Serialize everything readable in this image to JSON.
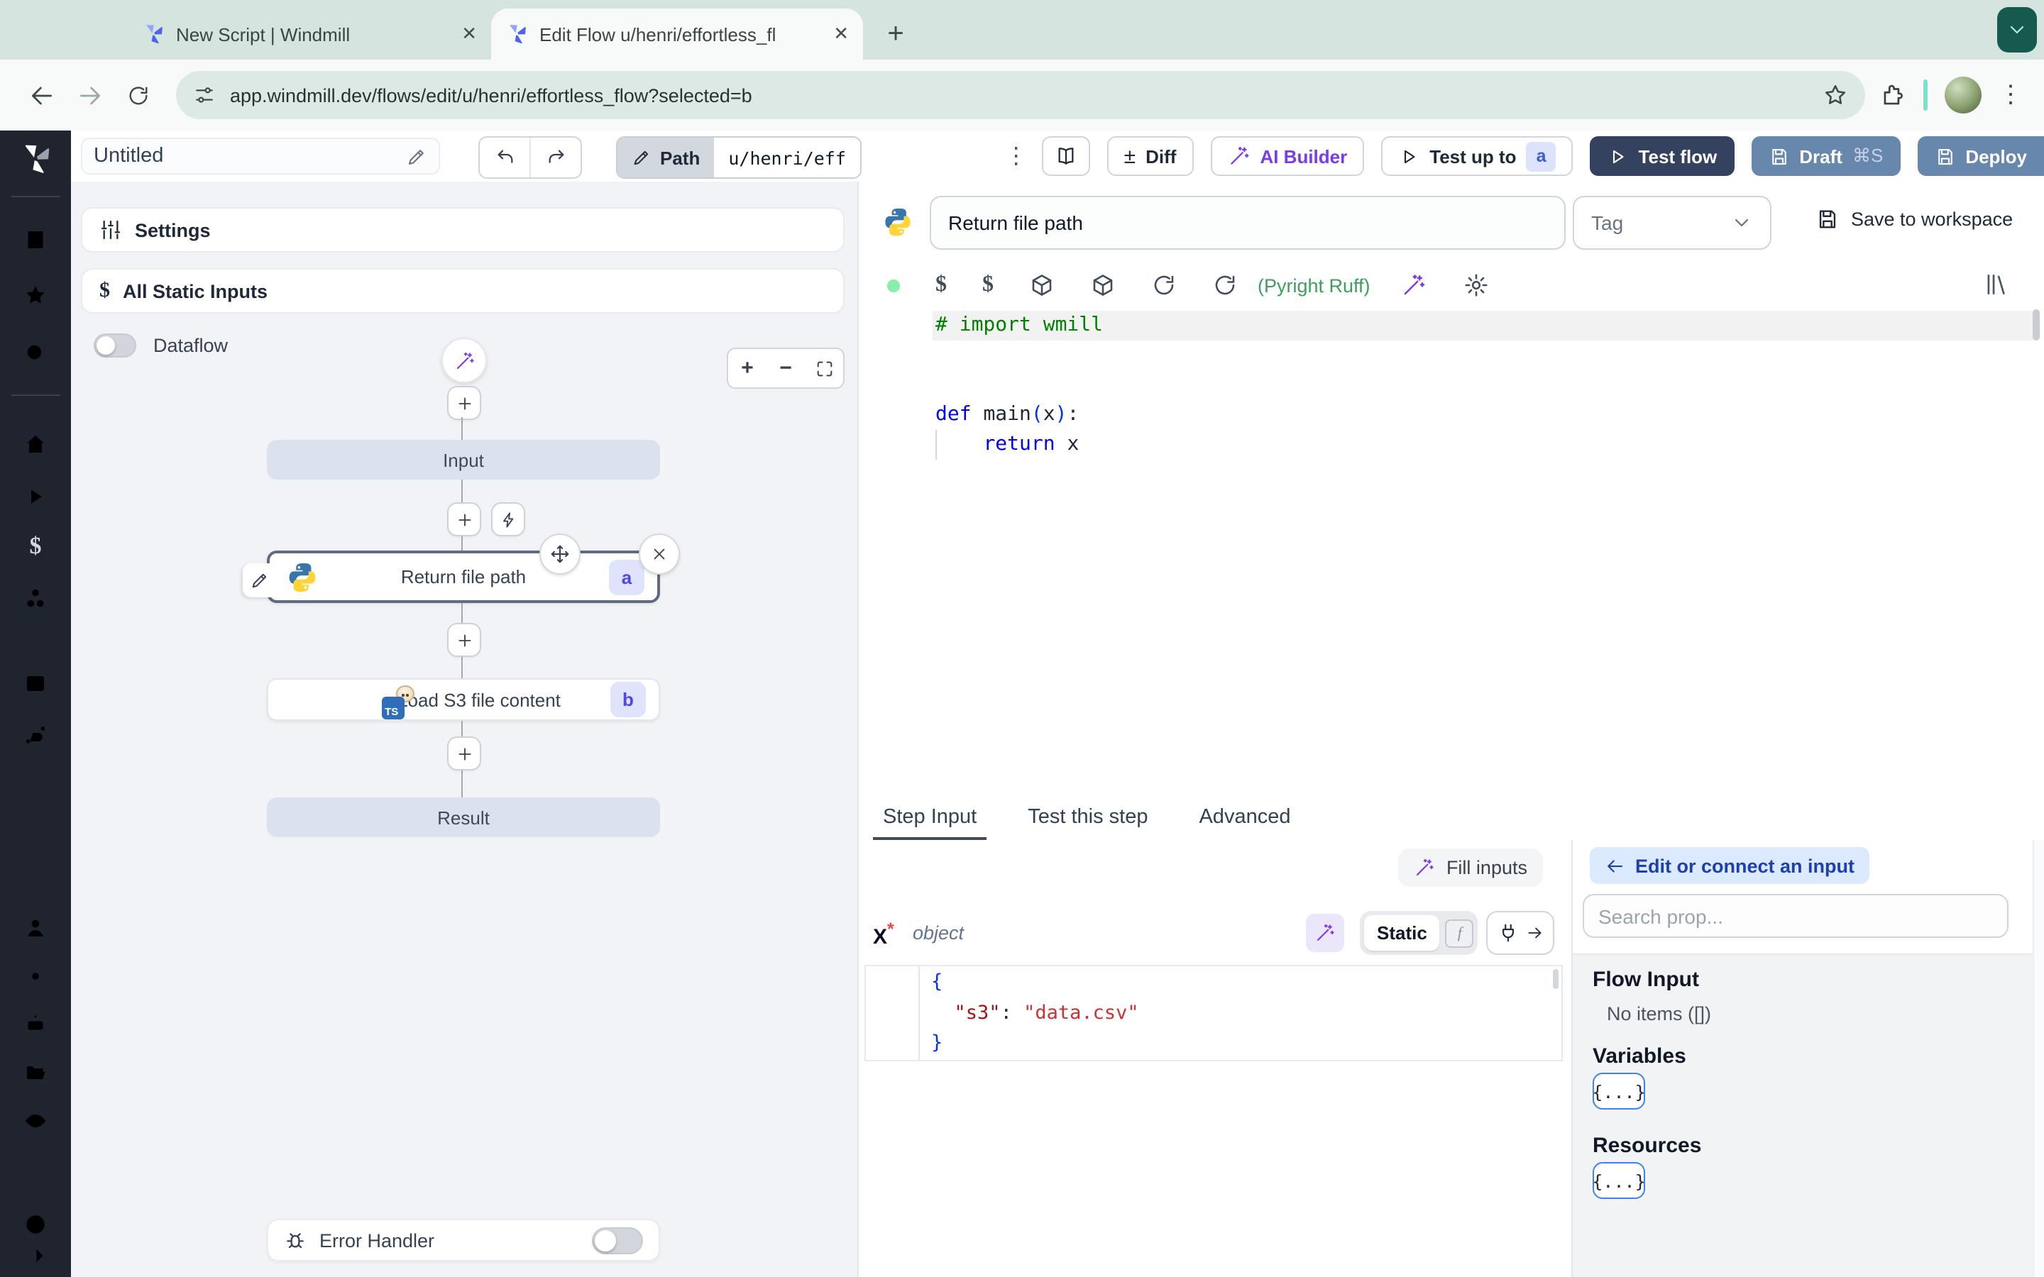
{
  "browser": {
    "tabs": [
      {
        "title": "New Script | Windmill"
      },
      {
        "title": "Edit Flow u/henri/effortless_fl"
      }
    ],
    "url": "app.windmill.dev/flows/edit/u/henri/effortless_flow?selected=b"
  },
  "sidebar": {
    "icons": [
      "windmill-logo",
      "workspace",
      "favorites",
      "search",
      "home",
      "runs",
      "variables",
      "resources",
      "schedules",
      "routes",
      "users",
      "settings",
      "workers",
      "folders",
      "audit-logs",
      "help",
      "collapse"
    ]
  },
  "app_toolbar": {
    "flow_name": "Untitled",
    "path_label": "Path",
    "path_value": "u/henri/eff",
    "diff_label": "Diff",
    "ai_builder_label": "AI Builder",
    "test_up_to_label": "Test up to",
    "test_up_to_badge": "a",
    "test_flow_label": "Test flow",
    "draft_label": "Draft",
    "draft_shortcut": "⌘S",
    "deploy_label": "Deploy"
  },
  "flow_panel": {
    "settings_label": "Settings",
    "static_inputs_label": "All Static Inputs",
    "dataflow_label": "Dataflow",
    "nodes": {
      "input": {
        "label": "Input"
      },
      "a": {
        "label": "Return file path",
        "badge": "a"
      },
      "b": {
        "label": "Load S3 file content",
        "badge": "b"
      },
      "result": {
        "label": "Result"
      }
    },
    "error_handler_label": "Error Handler"
  },
  "editor": {
    "step_name": "Return file path",
    "tag_placeholder": "Tag",
    "save_label": "Save to workspace",
    "lint_label": "(Pyright Ruff)",
    "code": {
      "language": "python",
      "lines": [
        [
          {
            "t": "# import wmill",
            "c": "comment"
          }
        ],
        [],
        [],
        [
          {
            "t": "def ",
            "c": "kw"
          },
          {
            "t": "main",
            "c": "plain"
          },
          {
            "t": "(",
            "c": "paren"
          },
          {
            "t": "x",
            "c": "plain"
          },
          {
            "t": ")",
            "c": "paren"
          },
          {
            "t": ":",
            "c": "plain"
          }
        ],
        [
          {
            "t": "    ",
            "c": "plain"
          },
          {
            "t": "return",
            "c": "kw"
          },
          {
            "t": " x",
            "c": "plain"
          }
        ]
      ]
    }
  },
  "step_panel": {
    "tabs": [
      {
        "label": "Step Input"
      },
      {
        "label": "Test this step"
      },
      {
        "label": "Advanced"
      }
    ],
    "fill_inputs_label": "Fill inputs",
    "arg": {
      "name": "X",
      "required": "*",
      "type": "object"
    },
    "static_label": "Static",
    "json": {
      "lines": [
        [
          {
            "t": "{",
            "c": "brace"
          }
        ],
        [
          {
            "t": "  ",
            "c": "plain"
          },
          {
            "t": "\"s3\"",
            "c": "key"
          },
          {
            "t": ": ",
            "c": "plain"
          },
          {
            "t": "\"data.csv\"",
            "c": "str"
          }
        ],
        [
          {
            "t": "}",
            "c": "brace"
          }
        ]
      ]
    }
  },
  "connect_panel": {
    "back_label": "Edit or connect an input",
    "search_placeholder": "Search prop...",
    "sections": [
      {
        "title": "Flow Input",
        "body": "No items ([])"
      },
      {
        "title": "Variables",
        "chip": "{...}"
      },
      {
        "title": "Resources",
        "chip": "{...}"
      }
    ]
  },
  "colors": {
    "accent_purple": "#7c3aed",
    "dark_button": "#35425f",
    "slate_button": "#6787ad",
    "badge_bg": "#dfe3fc",
    "badge_text": "#4f46e5",
    "connect_blue_bg": "#dbeafe",
    "connect_blue_text": "#1e40af",
    "lint_green": "#3f9d5f",
    "status_dot_green": "#86efac",
    "selected_node_border": "#5f6b7e",
    "browser_chrome": "#d5e4de",
    "sidebar_bg": "#1f242e"
  }
}
